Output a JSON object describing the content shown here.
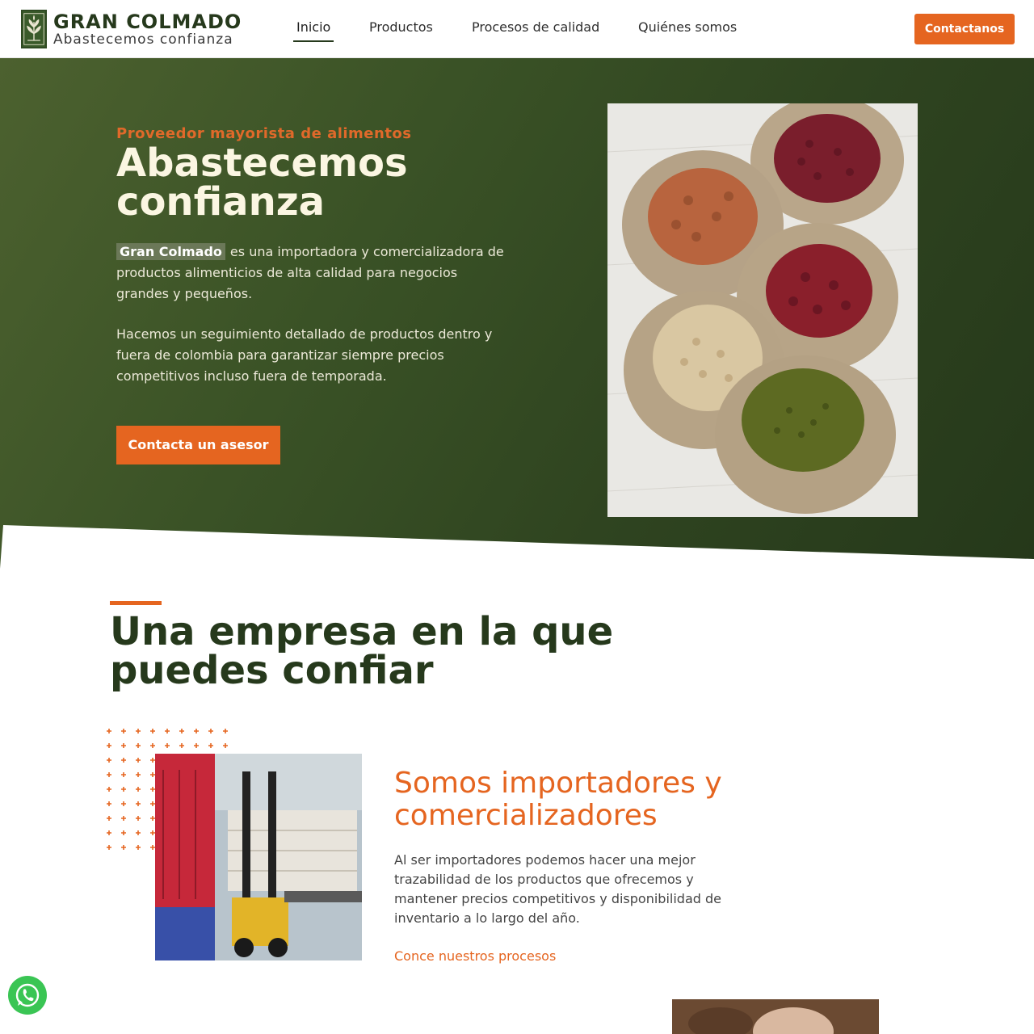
{
  "brand": {
    "name": "GRAN COLMADO",
    "tagline": "Abastecemos confianza",
    "colors": {
      "green": "#26391c",
      "orange": "#e56520"
    }
  },
  "nav": {
    "items": [
      {
        "label": "Inicio",
        "active": true
      },
      {
        "label": "Productos"
      },
      {
        "label": "Procesos de calidad"
      },
      {
        "label": "Quiénes somos"
      }
    ],
    "cta": "Contactanos"
  },
  "hero": {
    "eyebrow": "Proveedor mayorista de alimentos",
    "title": "Abastecemos confianza",
    "highlight": "Gran Colmado",
    "p1_rest": "es una importadora y comercializadora de productos alimenticios de alta calidad para negocios grandes y pequeños.",
    "p2": "Hacemos un seguimiento detallado de productos dentro y fuera de colombia para garantizar siempre precios competitivos incluso fuera de temporada.",
    "button": "Contacta un asesor"
  },
  "about": {
    "title": "Una empresa en la que puedes confiar",
    "feature_title": "Somos importadores y comercializadores",
    "feature_body": "Al ser importadores podemos hacer una mejor trazabilidad de los productos que ofrecemos y mantener precios competitivos y disponibilidad de inventario a lo largo del año.",
    "feature_link": "Conce nuestros procesos"
  },
  "whatsapp": {
    "icon": "whatsapp-icon"
  }
}
